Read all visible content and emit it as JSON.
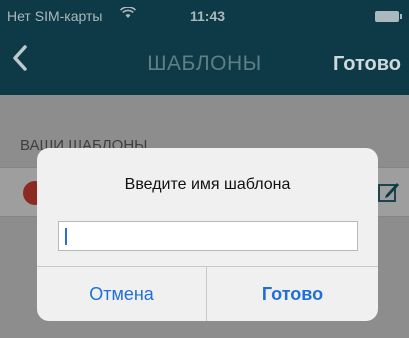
{
  "status_bar": {
    "carrier": "Нет SIM-карты",
    "wifi_icon": "wifi-icon",
    "time": "11:43",
    "battery_icon": "battery-icon"
  },
  "nav": {
    "back_icon": "chevron-left-icon",
    "title": "ШАБЛОНЫ",
    "done": "Готово"
  },
  "content": {
    "section_header": "ВАШИ ШАБЛОНЫ",
    "row": {
      "delete_icon": "delete-circle-icon",
      "edit_icon": "edit-icon"
    }
  },
  "alert": {
    "title": "Введите имя шаблона",
    "input_value": "",
    "cancel": "Отмена",
    "ok": "Готово"
  },
  "colors": {
    "nav_bg": "#0d3a46",
    "accent": "#1f6fd8",
    "dim_bg": "#8d8d8d"
  }
}
